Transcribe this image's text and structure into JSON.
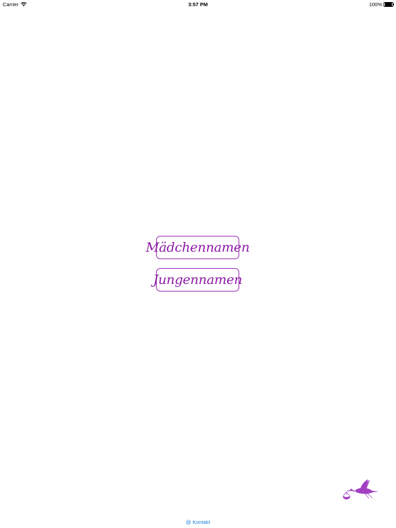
{
  "status_bar": {
    "carrier": "Carrier",
    "time": "3:57 PM",
    "battery": "100%",
    "battery_level": 1.0,
    "wifi_icon": "wifi-icon",
    "battery_icon": "battery-icon"
  },
  "main": {
    "girls_button_label": "Mädchennamen",
    "boys_button_label": "Jungennamen"
  },
  "footer": {
    "contact_label": "@ Kontakt",
    "logo_icon": "stork-icon"
  },
  "colors": {
    "accent": "#8a1aa3",
    "border": "#9b30b5",
    "link": "#1a7fe0",
    "logo": "#a23fc2"
  }
}
